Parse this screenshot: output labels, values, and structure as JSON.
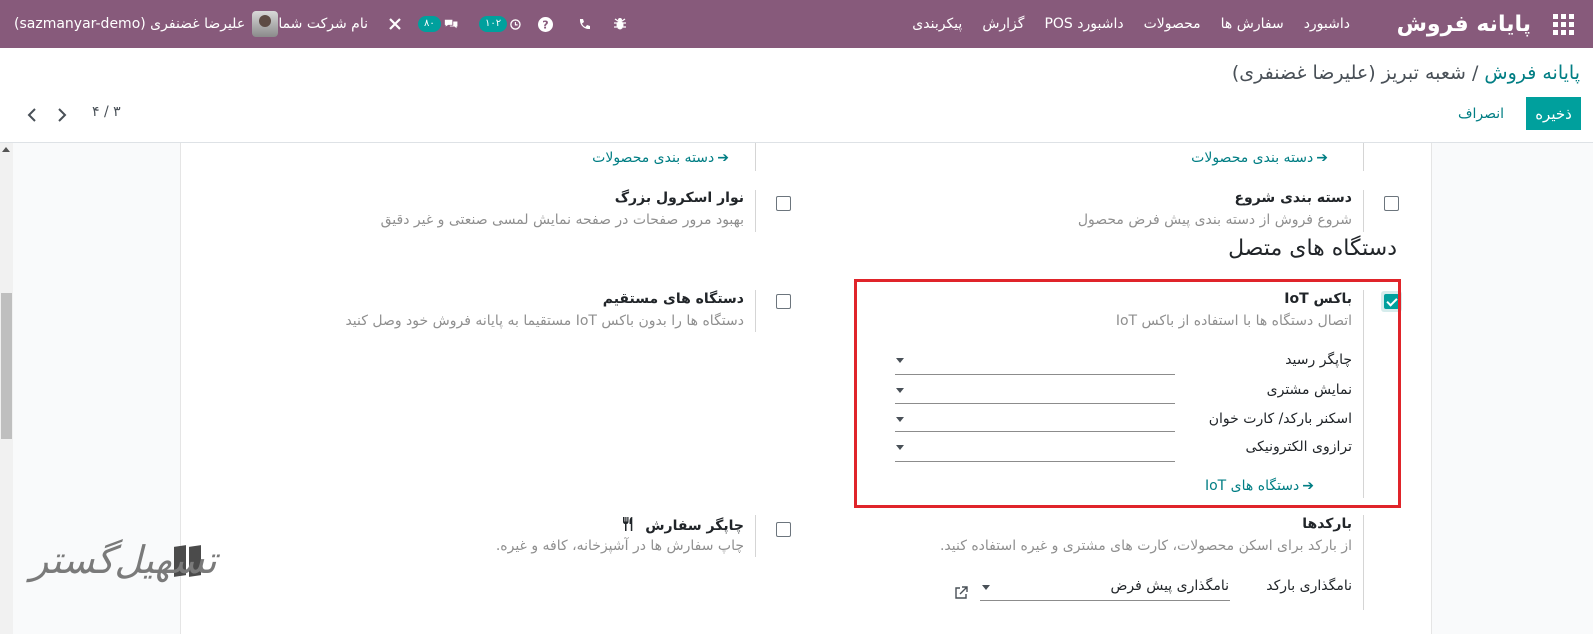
{
  "navbar": {
    "brand": "پایانه فروش",
    "menu": [
      "داشبورد",
      "سفارش ها",
      "محصولات",
      "داشبورد POS",
      "گزارش",
      "پیکربندی"
    ],
    "activities_count": "۱۰۲",
    "messages_count": "۸۰",
    "company_name": "نام شرکت شما",
    "user_name": "علیرضا غضنفری (sazmanyar-demo)"
  },
  "control_panel": {
    "breadcrumb_root": "پایانه فروش",
    "breadcrumb_separator": "/",
    "breadcrumb_current": "شعبه تبریز (علیرضا غضنفری)",
    "save_label": "ذخیره",
    "discard_label": "انصراف",
    "pager": "۴ / ۳"
  },
  "form": {
    "top_links": {
      "right": "دسته بندی محصولات",
      "left": "دسته بندی محصولات"
    },
    "start_category": {
      "title": "دسته بندی شروع",
      "description": "شروع فروش از دسته بندی پیش فرض محصول",
      "checked": false
    },
    "large_scrollbar": {
      "title": "نوار اسکرول بزرگ",
      "description": "بهبود مرور صفحات در صفحه نمایش لمسی صنعتی و غیر دقیق",
      "checked": false
    },
    "connected_devices_heading": "دستگاه های متصل",
    "iot_box": {
      "title": "باکس IoT",
      "description": "اتصال دستگاه ها با استفاده از باکس IoT",
      "checked": true,
      "fields": [
        {
          "label": "چاپگر رسید",
          "value": ""
        },
        {
          "label": "نمایش مشتری",
          "value": ""
        },
        {
          "label": "اسکنر بارکد/ کارت خوان",
          "value": ""
        },
        {
          "label": "ترازوی الکترونیکی",
          "value": ""
        }
      ],
      "link": "دستگاه های IoT"
    },
    "direct_devices": {
      "title": "دستگاه های مستقیم",
      "description": "دستگاه ها را بدون باکس IoT مستقیما به پایانه فروش خود وصل کنید",
      "checked": false
    },
    "barcodes": {
      "title": "بارکدها",
      "description": "از بارکد برای اسکن محصولات، کارت های مشتری و غیره استفاده کنید.",
      "nomenclature_label": "نامگذاری بارکد",
      "nomenclature_value": "نامگذاری پیش فرض"
    },
    "order_printer": {
      "title": "چاپگر سفارش",
      "description": "چاپ سفارش ها در آشپزخانه، کافه و غیره.",
      "checked": false
    }
  },
  "colors": {
    "navbar": "#875a7b",
    "accent": "#00a09d",
    "link": "#017e84",
    "highlight": "#e0242a"
  }
}
